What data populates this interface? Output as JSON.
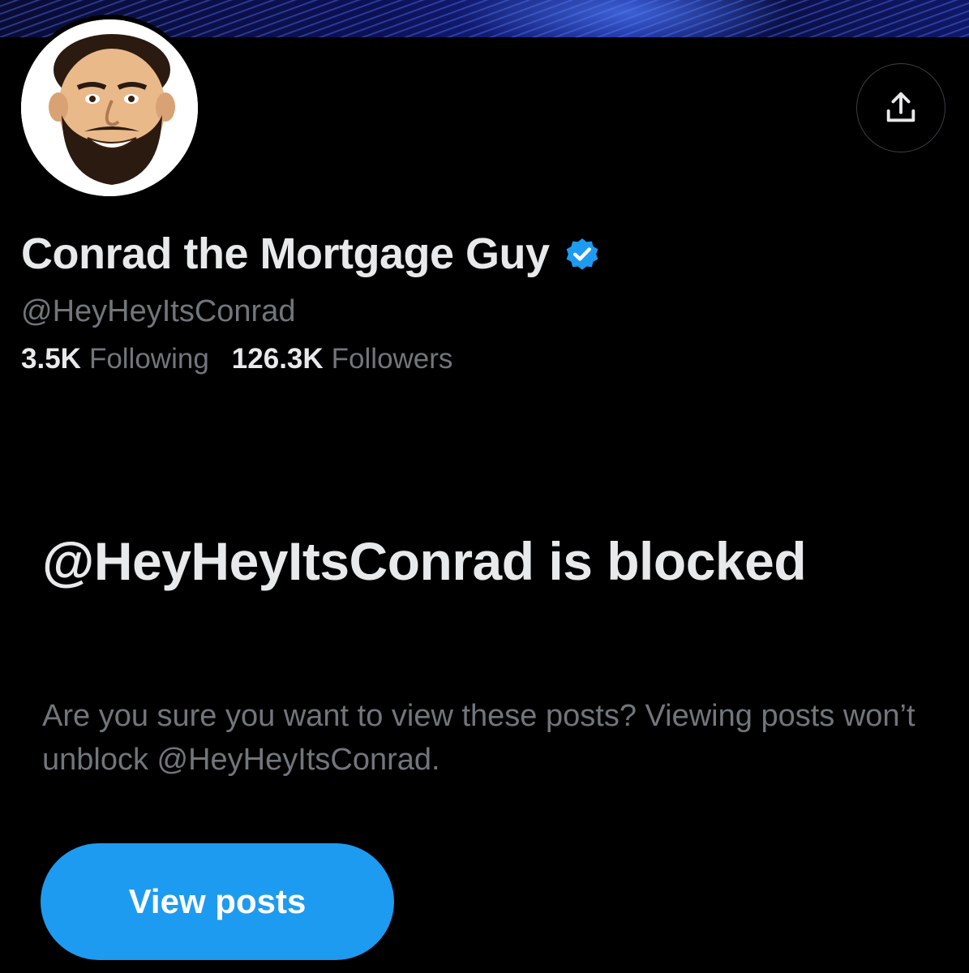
{
  "banner": {
    "description_icon": "blue-abstract-banner"
  },
  "profile": {
    "avatar_icon": "caricature-avatar",
    "display_name": "Conrad the Mortgage Guy",
    "verified_icon": "verified-badge-icon",
    "handle": "@HeyHeyItsConrad",
    "following_count": "3.5K",
    "following_label": "Following",
    "followers_count": "126.3K",
    "followers_label": "Followers"
  },
  "actions": {
    "share_icon": "share-upload-icon"
  },
  "blocked_notice": {
    "title": "@HeyHeyItsConrad is blocked",
    "description": "Are you sure you want to view these posts? Viewing posts won’t unblock @HeyHeyItsConrad.",
    "view_posts_label": "View posts"
  },
  "colors": {
    "accent": "#1d9bf0",
    "background": "#000000",
    "primary_text": "#e7e9ea",
    "secondary_text": "#71767b"
  }
}
